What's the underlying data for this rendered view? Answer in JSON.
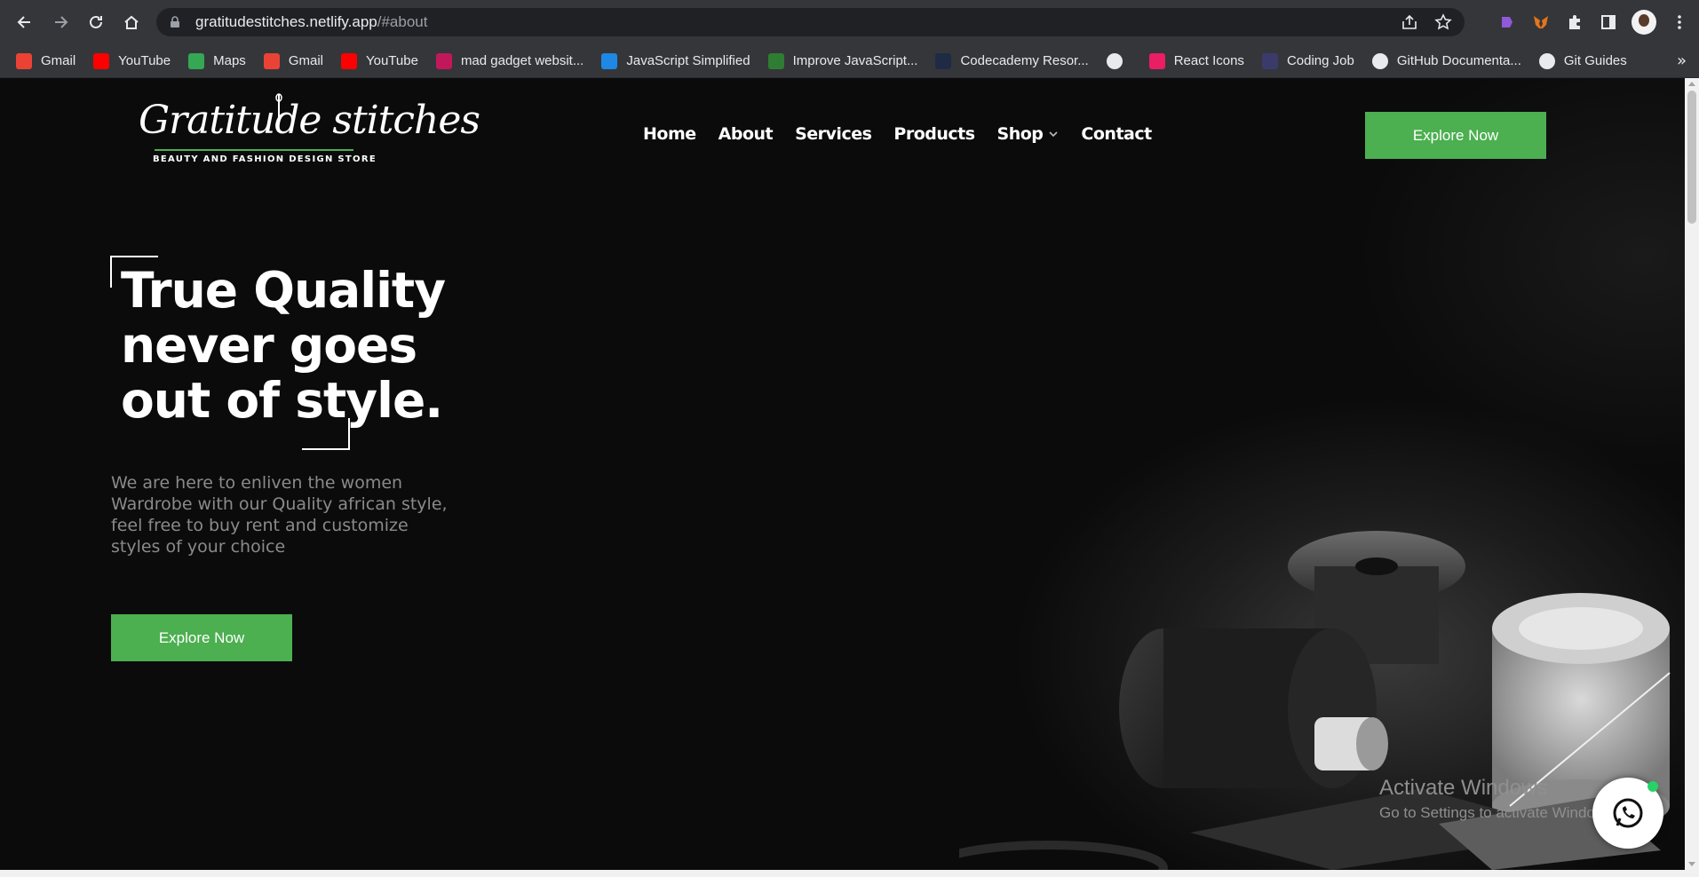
{
  "browser": {
    "url_host": "gratitudestitches.netlify.app",
    "url_path": "/#about",
    "bookmarks": [
      {
        "label": "Gmail",
        "icon": "gmail-icon",
        "color": "#ea4335"
      },
      {
        "label": "YouTube",
        "icon": "youtube-icon",
        "color": "#ff0000"
      },
      {
        "label": "Maps",
        "icon": "maps-icon",
        "color": "#34a853"
      },
      {
        "label": "Gmail",
        "icon": "gmail-icon",
        "color": "#ea4335"
      },
      {
        "label": "YouTube",
        "icon": "youtube-icon",
        "color": "#ff0000"
      },
      {
        "label": "mad gadget websit...",
        "icon": "triangle-logo-icon",
        "color": "#c2185b"
      },
      {
        "label": "JavaScript Simplified",
        "icon": "js-simplified-icon",
        "color": "#1e88e5"
      },
      {
        "label": "Improve JavaScript...",
        "icon": "glasses-icon",
        "color": "#2e7d32"
      },
      {
        "label": "Codecademy Resor...",
        "icon": "codecademy-icon",
        "color": "#1f2a44"
      },
      {
        "label": "",
        "icon": "globe-icon",
        "color": "#e8eaed"
      },
      {
        "label": "React Icons",
        "icon": "react-icon",
        "color": "#e91e63"
      },
      {
        "label": "Coding Job",
        "icon": "coding-job-icon",
        "color": "#3b3b6b"
      },
      {
        "label": "GitHub Documenta...",
        "icon": "github-icon",
        "color": "#e8eaed"
      },
      {
        "label": "Git Guides",
        "icon": "github-icon",
        "color": "#e8eaed"
      }
    ],
    "more": "»"
  },
  "site": {
    "logo_script": "Gratitude stitches",
    "logo_tagline": "BEAUTY AND FASHION DESIGN STORE",
    "nav": [
      "Home",
      "About",
      "Services",
      "Products",
      "Shop",
      "Contact"
    ],
    "cta_top": "Explore Now",
    "headline": "True Quality never goes out of style.",
    "subtext": "We are here to enliven the women Wardrobe with our Quality african style, feel free to buy rent and customize styles of your choice",
    "cta_hero": "Explore Now",
    "accent": "#4caf50"
  },
  "overlay": {
    "activate_title": "Activate Windows",
    "activate_sub": "Go to Settings to activate Windows."
  }
}
